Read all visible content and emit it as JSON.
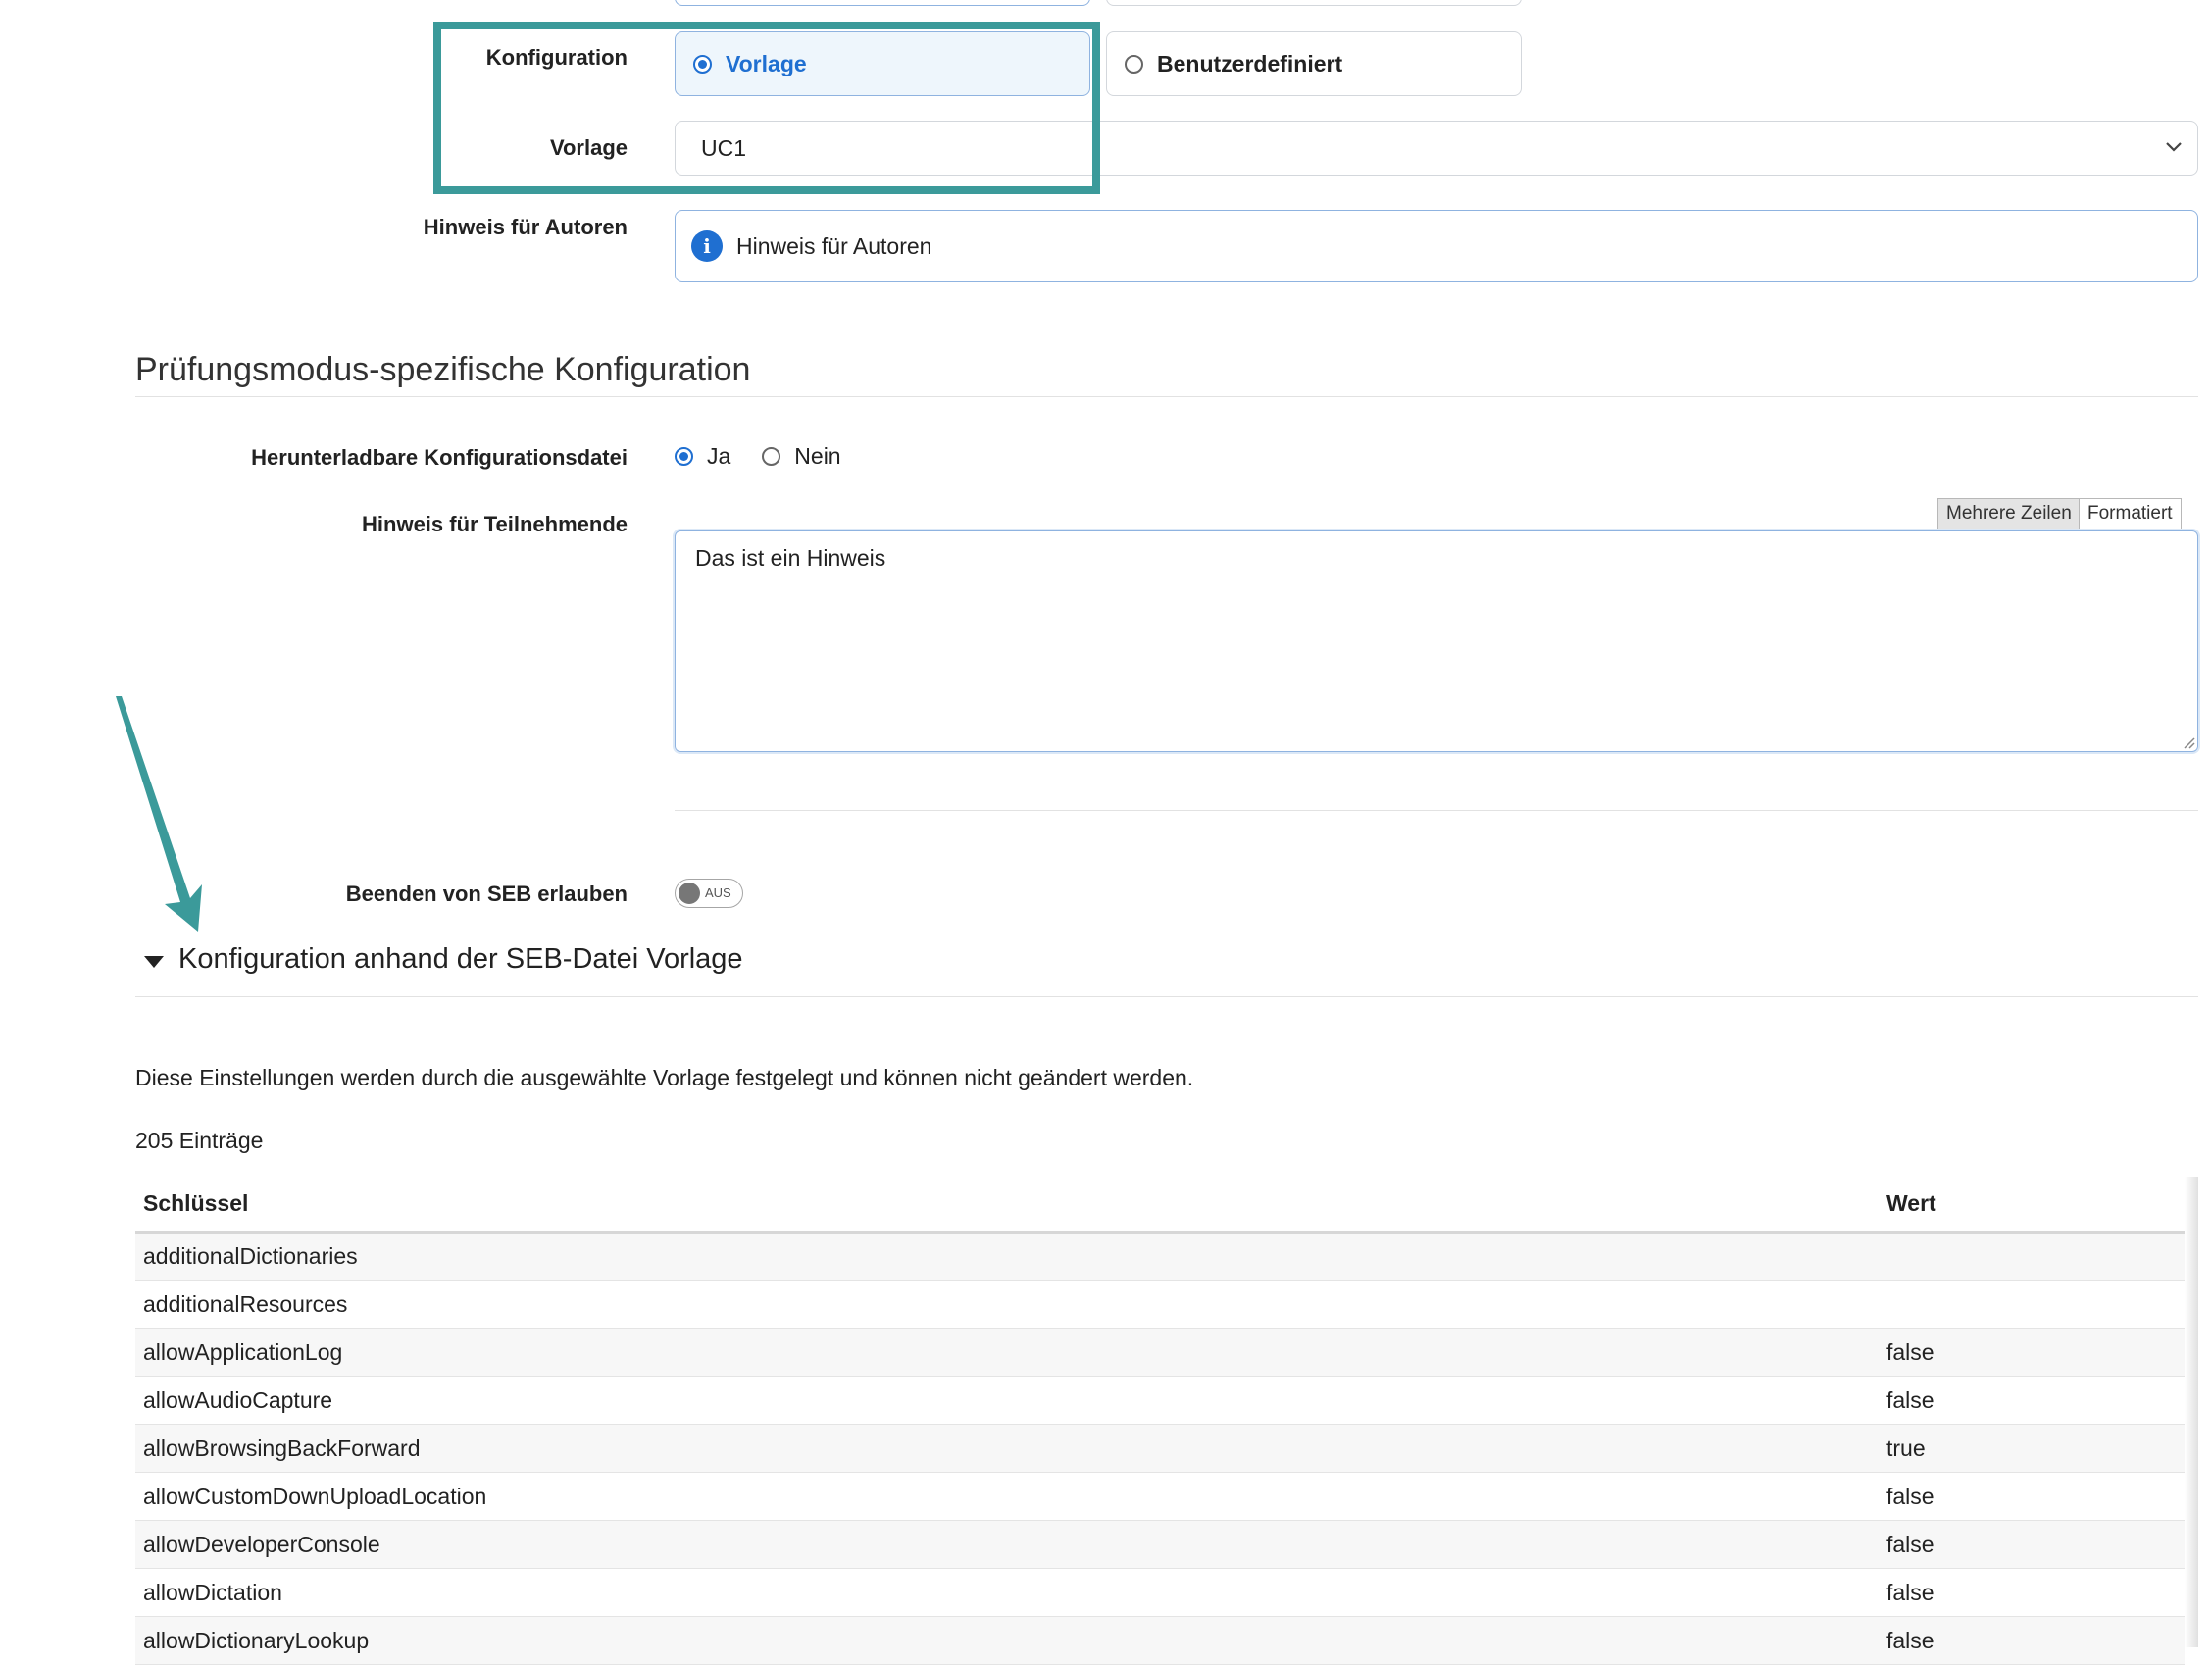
{
  "config": {
    "label": "Konfiguration",
    "option_template": "Vorlage",
    "option_custom": "Benutzerdefiniert",
    "selected": "Vorlage"
  },
  "template": {
    "label": "Vorlage",
    "value": "UC1"
  },
  "author_hint": {
    "label": "Hinweis für Autoren",
    "text": "Hinweis für Autoren"
  },
  "exam_section": {
    "title": "Prüfungsmodus-spezifische Konfiguration"
  },
  "downloadable": {
    "label": "Herunterladbare Konfigurationsdatei",
    "yes": "Ja",
    "no": "Nein",
    "selected": "Ja"
  },
  "participant_hint": {
    "label": "Hinweis für Teilnehmende",
    "tab_multiline": "Mehrere Zeilen",
    "tab_formatted": "Formatiert",
    "text": "Das ist ein Hinweis"
  },
  "allow_quit": {
    "label": "Beenden von SEB erlauben",
    "toggle_text": "AUS",
    "state": "off"
  },
  "seb_section": {
    "title": "Konfiguration anhand der SEB-Datei Vorlage",
    "description": "Diese Einstellungen werden durch die ausgewählte Vorlage festgelegt und können nicht geändert werden.",
    "count": "205 Einträge"
  },
  "table": {
    "headers": [
      "Schlüssel",
      "Wert"
    ],
    "rows": [
      [
        "additionalDictionaries",
        ""
      ],
      [
        "additionalResources",
        ""
      ],
      [
        "allowApplicationLog",
        "false"
      ],
      [
        "allowAudioCapture",
        "false"
      ],
      [
        "allowBrowsingBackForward",
        "true"
      ],
      [
        "allowCustomDownUploadLocation",
        "false"
      ],
      [
        "allowDeveloperConsole",
        "false"
      ],
      [
        "allowDictation",
        "false"
      ],
      [
        "allowDictionaryLookup",
        "false"
      ]
    ]
  },
  "colors": {
    "accent": "#1f6fd1",
    "highlight": "#3b9a9a",
    "info_border": "#8fb3e0"
  }
}
